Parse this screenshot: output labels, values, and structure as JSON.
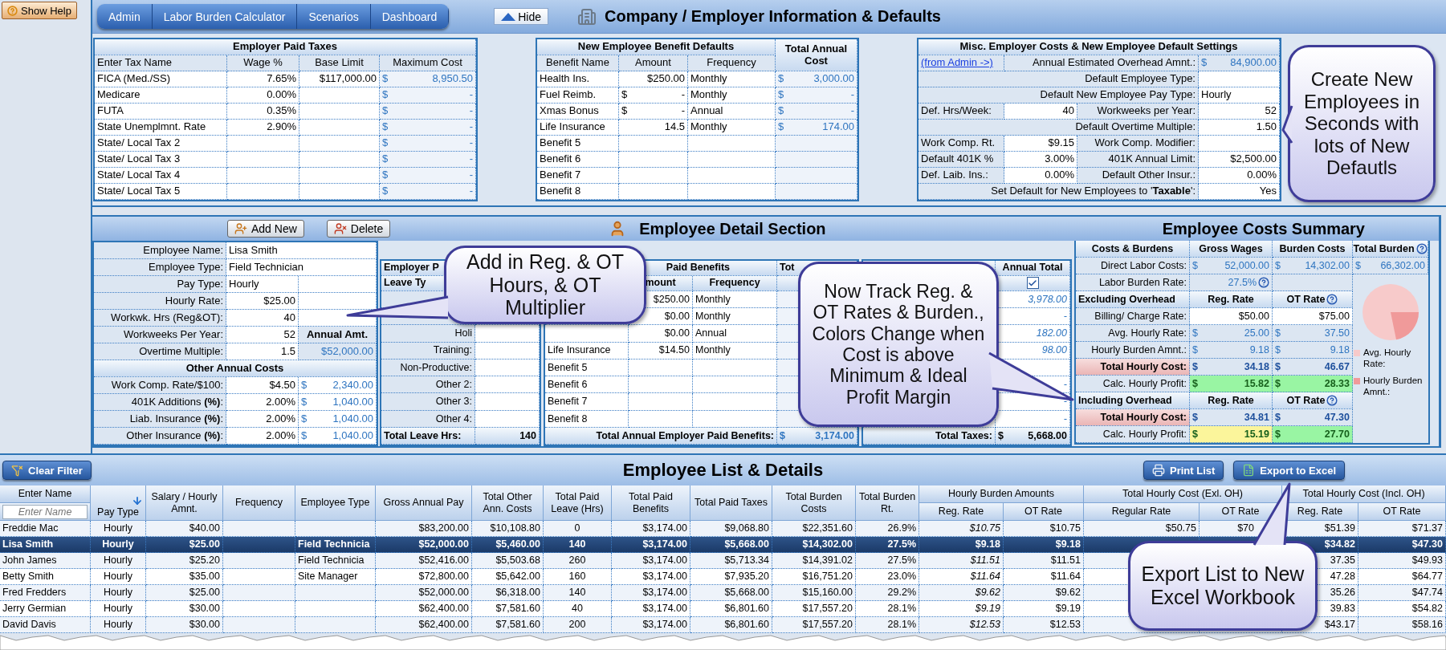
{
  "show_help": "Show Help",
  "nav": {
    "buttons": [
      "Admin",
      "Labor Burden Calculator",
      "Scenarios",
      "Dashboard"
    ],
    "hide_button": "Hide",
    "title": "Company / Employer Information & Defaults"
  },
  "company": {
    "taxes": {
      "title": "Employer Paid Taxes",
      "columns": [
        "Enter Tax Name",
        "Wage %",
        "Base Limit",
        "Maximum Cost"
      ],
      "rows": [
        [
          "FICA (Med./SS)",
          "7.65%",
          "$117,000.00",
          {
            "s": "$",
            "v": "8,950.50"
          }
        ],
        [
          "Medicare",
          "0.00%",
          null,
          {
            "s": "$",
            "v": "-"
          }
        ],
        [
          "FUTA",
          "0.35%",
          null,
          {
            "s": "$",
            "v": "-"
          }
        ],
        [
          "State Unemplmnt. Rate",
          "2.90%",
          null,
          {
            "s": "$",
            "v": "-"
          }
        ],
        [
          "State/ Local Tax 2",
          null,
          null,
          {
            "s": "$",
            "v": "-"
          }
        ],
        [
          "State/ Local Tax 3",
          null,
          null,
          {
            "s": "$",
            "v": "-"
          }
        ],
        [
          "State/ Local Tax 4",
          null,
          null,
          {
            "s": "$",
            "v": "-"
          }
        ],
        [
          "State/ Local Tax 5",
          null,
          null,
          {
            "s": "$",
            "v": "-"
          }
        ]
      ]
    },
    "benefit_defaults": {
      "title": "New Employee Benefit Defaults",
      "total_title": "Total Annual Cost",
      "columns": [
        "Benefit Name",
        "Amount",
        "Frequency"
      ],
      "rows": [
        [
          "Health Ins.",
          "$250.00",
          "Monthly",
          {
            "s": "$",
            "v": "3,000.00"
          }
        ],
        [
          "Fuel Reimb.",
          {
            "s": "$",
            "v": "-"
          },
          "Monthly",
          {
            "s": "$",
            "v": "-"
          }
        ],
        [
          "Xmas Bonus",
          {
            "s": "$",
            "v": "-"
          },
          "Annual",
          {
            "s": "$",
            "v": "-"
          }
        ],
        [
          "Life Insurance",
          "14.5",
          "Monthly",
          {
            "s": "$",
            "v": "174.00"
          }
        ],
        [
          "Benefit 5",
          null,
          null,
          null
        ],
        [
          "Benefit 6",
          null,
          null,
          null
        ],
        [
          "Benefit 7",
          null,
          null,
          null
        ],
        [
          "Benefit 8",
          null,
          null,
          null
        ]
      ]
    },
    "misc": {
      "title": "Misc. Employer Costs & New Employee Default Settings",
      "rows": [
        {
          "kind": "link",
          "link": "(from Admin ->)",
          "label": "Annual Estimated Overhead Amnt.:",
          "value": {
            "s": "$",
            "v": "84,900.00"
          }
        },
        {
          "kind": "single",
          "label": "Default Employee Type:"
        },
        {
          "kind": "choice",
          "label": "Default New Employee Pay Type:",
          "value": "Hourly"
        },
        {
          "kind": "pair",
          "label": "Def. Hrs/Week:",
          "value": "40",
          "label2": "Workweeks per Year:",
          "value2": "52"
        },
        {
          "kind": "single",
          "label": "Default Overtime Multiple:",
          "value": "1.50"
        },
        {
          "kind": "pair",
          "label": "Work Comp. Rt.",
          "value": "$9.15",
          "label2": "Work Comp. Modifier:"
        },
        {
          "kind": "pair",
          "label": "Default 401K %",
          "value": "3.00%",
          "label2": "401K Annual Limit:",
          "value2": "$2,500.00"
        },
        {
          "kind": "pair",
          "label": "Def. Laib. Ins.:",
          "value": "0.00%",
          "label2": "Default Other Insur.:",
          "value2": "0.00%"
        },
        {
          "kind": "single",
          "label": "Set Default for New Employees to '**Taxable**':",
          "value": "Yes"
        }
      ]
    }
  },
  "detail": {
    "add_button": "Add New",
    "delete_button": "Delete",
    "title": "Employee Detail Section",
    "summary_title": "Employee Costs Summary",
    "employee": {
      "rows": [
        {
          "kind": "wide",
          "label": "Employee Name:",
          "value": "Lisa Smith"
        },
        {
          "kind": "wide",
          "label": "Employee Type:",
          "value": "Field Technician"
        },
        {
          "kind": "split",
          "label": "Pay Type:",
          "value": "Hourly"
        },
        {
          "kind": "split",
          "label": "Hourly Rate:",
          "value": "$25.00"
        },
        {
          "kind": "split",
          "label": "Workwk. Hrs (Reg&OT):",
          "value": "40"
        },
        {
          "kind": "split",
          "label": "Workweeks Per Year:",
          "value": "52",
          "heading": "Annual Amt."
        },
        {
          "kind": "split",
          "label": "Overtime Multiple:",
          "value": "1.5",
          "amount": "$52,000.00"
        }
      ],
      "other_title": "Other  Annual Costs",
      "other_rows": [
        {
          "label": "Work Comp. Rate/$100:",
          "value": "$4.50",
          "amount": {
            "s": "$",
            "v": "2,340.00"
          }
        },
        {
          "label": "401K Additions **(%)**:",
          "value": "2.00%",
          "amount": {
            "s": "$",
            "v": "1,040.00"
          }
        },
        {
          "label": "Liab. Insurance **(%)**:",
          "value": "2.00%",
          "amount": {
            "s": "$",
            "v": "1,040.00"
          }
        },
        {
          "label": "Other Insurance **(%)**:",
          "value": "2.00%",
          "amount": {
            "s": "$",
            "v": "1,040.00"
          }
        }
      ]
    },
    "leave": {
      "title": "Employer P",
      "column": "Leave Ty",
      "rows": [
        null,
        null,
        "Holi",
        "Training:",
        "Non-Productive:",
        "Other 2:",
        "Other 3:",
        "Other 4:"
      ],
      "footer_label": "Total Leave Hrs:",
      "footer_value": "140"
    },
    "emp_benefits": {
      "title": "Paid Benefits",
      "total_column": "Tot",
      "columns": [
        "mount",
        "Frequency"
      ],
      "rows": [
        {
          "amount": "$250.00",
          "frequency": "Monthly"
        },
        {
          "amount": "$0.00",
          "frequency": "Monthly"
        },
        {
          "amount": "$0.00",
          "frequency": "Annual"
        },
        {
          "name": "Life Insurance",
          "amount": "$14.50",
          "frequency": "Monthly"
        },
        {
          "name": "Benefit 5"
        },
        {
          "name": "Benefit 6"
        },
        {
          "name": "Benefit 7"
        },
        {
          "name": "Benefit 8"
        }
      ],
      "footer_label": "Total Annual Employer Paid Benefits:",
      "footer_total": {
        "s": "$",
        "v": "3,174.00"
      }
    },
    "emp_taxes": {
      "column": "Annual Total",
      "checked": true,
      "rows": [
        "3,978.00",
        "-",
        "182.00",
        "98.00",
        null,
        "-",
        "-",
        "-"
      ],
      "footer_label": "Total Taxes:",
      "footer_total": {
        "s": "$",
        "v": "5,668.00"
      }
    },
    "summary": {
      "columns": [
        "Costs & Burdens",
        "Gross Wages",
        "Burden Costs",
        "Total Burden"
      ],
      "direct_label": "Direct Labor Costs:",
      "direct_values": [
        {
          "s": "$",
          "v": "52,000.00"
        },
        {
          "s": "$",
          "v": "14,302.00"
        },
        {
          "s": "$",
          "v": "66,302.00"
        }
      ],
      "rows": [
        {
          "kind": "rate",
          "label": "Labor Burden Rate:",
          "reg": "27.5%",
          "help": true
        },
        {
          "kind": "section",
          "label": "Excluding Overhead",
          "reg": "Reg. Rate",
          "ot": "OT Rate",
          "help": true
        },
        {
          "kind": "value",
          "label": "Billing/ Charge Rate:",
          "reg": "$50.00",
          "ot": "$75.00"
        },
        {
          "kind": "value",
          "label": "Avg. Hourly Rate:",
          "reg": {
            "s": "$",
            "v": "25.00"
          },
          "ot": {
            "s": "$",
            "v": "37.50"
          }
        },
        {
          "kind": "value",
          "label": "Hourly Burden Amnt.:",
          "reg": {
            "s": "$",
            "v": "9.18"
          },
          "ot": {
            "s": "$",
            "v": "9.18"
          }
        },
        {
          "kind": "cost",
          "label": "Total Hourly Cost:",
          "reg": {
            "s": "$",
            "v": "34.18"
          },
          "ot": {
            "s": "$",
            "v": "46.67"
          }
        },
        {
          "kind": "profit",
          "label": "Calc. Hourly Profit:",
          "reg": {
            "s": "$",
            "v": "15.82",
            "color": "#99f5a3"
          },
          "ot": {
            "s": "$",
            "v": "28.33",
            "color": "#99f5a3"
          }
        },
        {
          "kind": "section",
          "label": "Including Overhead",
          "reg": "Reg. Rate",
          "ot": "OT Rate",
          "help": true
        },
        {
          "kind": "cost",
          "label": "Total Hourly Cost:",
          "reg": {
            "s": "$",
            "v": "34.81"
          },
          "ot": {
            "s": "$",
            "v": "47.30"
          }
        },
        {
          "kind": "profit",
          "label": "Calc. Hourly Profit:",
          "reg": {
            "s": "$",
            "v": "15.19",
            "color": "#fbf59b"
          },
          "ot": {
            "s": "$",
            "v": "27.70",
            "color": "#99f5a3"
          }
        }
      ],
      "total_help": true,
      "legend": [
        {
          "label": "Avg. Hourly Rate:",
          "color": "#f7caca"
        },
        {
          "label": "Hourly Burden Amnt.:",
          "color": "#f09a9a"
        }
      ]
    }
  },
  "list": {
    "clear_filter": "Clear Filter",
    "title": "Employee List & Details",
    "print_button": "Print List",
    "export_button": "Export to Excel",
    "header": [
      {
        "kind": "filter",
        "label": "Enter Name",
        "placeholder": "Enter Name"
      },
      {
        "kind": "single",
        "label": "Pay Type",
        "sorted": true
      },
      {
        "kind": "single",
        "label": "Salary / Hourly Amnt."
      },
      {
        "kind": "single",
        "label": "Frequency"
      },
      {
        "kind": "single",
        "label": "Employee Type"
      },
      {
        "kind": "single",
        "label": "Gross Annual Pay"
      },
      {
        "kind": "single",
        "label": "Total Other Ann. Costs"
      },
      {
        "kind": "single",
        "label": "Total Paid Leave (Hrs)"
      },
      {
        "kind": "single",
        "label": "Total Paid Benefits"
      },
      {
        "kind": "single",
        "label": "Total Paid Taxes"
      },
      {
        "kind": "single",
        "label": "Total Burden Costs"
      },
      {
        "kind": "single",
        "label": "Total Burden Rt."
      },
      {
        "kind": "group",
        "label": "Hourly Burden Amounts",
        "subs": [
          "Reg. Rate",
          "OT Rate"
        ]
      },
      {
        "kind": "group",
        "label": "Total Hourly Cost (Exl. OH)",
        "subs": [
          "Regular Rate",
          "OT Rate"
        ]
      },
      {
        "kind": "group",
        "label": "Total Hourly Cost (Incl. OH)",
        "subs": [
          "Reg. Rate",
          "OT Rate"
        ]
      }
    ],
    "rows": [
      {
        "selected": false,
        "cells": [
          "Freddie Mac",
          "Hourly",
          "$40.00",
          null,
          null,
          "$83,200.00",
          "$10,108.80",
          "0",
          "$3,174.00",
          "$9,068.80",
          "$22,351.60",
          "26.9%",
          "$10.75",
          "$10.75",
          "$50.75",
          "$70",
          "$51.39",
          "$71.37"
        ]
      },
      {
        "selected": true,
        "cells": [
          "Lisa Smith",
          "Hourly",
          "$25.00",
          null,
          "Field Technicia",
          "$52,000.00",
          "$5,460.00",
          "140",
          "$3,174.00",
          "$5,668.00",
          "$14,302.00",
          "27.5%",
          "$9.18",
          "$9.18",
          null,
          null,
          "$34.82",
          "$47.30"
        ]
      },
      {
        "selected": false,
        "cells": [
          "John James",
          "Hourly",
          "$25.20",
          null,
          "Field Technicia",
          "$52,416.00",
          "$5,503.68",
          "260",
          "$3,174.00",
          "$5,713.34",
          "$14,391.02",
          "27.5%",
          "$11.51",
          "$11.51",
          null,
          null,
          "37.35",
          "$49.93"
        ]
      },
      {
        "selected": false,
        "cells": [
          "Betty Smith",
          "Hourly",
          "$35.00",
          null,
          "Site Manager",
          "$72,800.00",
          "$5,642.00",
          "160",
          "$3,174.00",
          "$7,935.20",
          "$16,751.20",
          "23.0%",
          "$11.64",
          "$11.64",
          null,
          null,
          "47.28",
          "$64.77"
        ]
      },
      {
        "selected": false,
        "cells": [
          "Fred Fredders",
          "Hourly",
          "$25.00",
          null,
          null,
          "$52,000.00",
          "$6,318.00",
          "140",
          "$3,174.00",
          "$5,668.00",
          "$15,160.00",
          "29.2%",
          "$9.62",
          "$9.62",
          null,
          null,
          "35.26",
          "$47.74"
        ]
      },
      {
        "selected": false,
        "cells": [
          "Jerry Germian",
          "Hourly",
          "$30.00",
          null,
          null,
          "$62,400.00",
          "$7,581.60",
          "40",
          "$3,174.00",
          "$6,801.60",
          "$17,557.20",
          "28.1%",
          "$9.19",
          "$9.19",
          null,
          null,
          "39.83",
          "$54.82"
        ]
      },
      {
        "selected": false,
        "cells": [
          "David Davis",
          "Hourly",
          "$30.00",
          null,
          null,
          "$62,400.00",
          "$7,581.60",
          "200",
          "$3,174.00",
          "$6,801.60",
          "$17,557.20",
          "28.1%",
          "$12.53",
          "$12.53",
          null,
          null,
          "$43.17",
          "$58.16"
        ]
      }
    ]
  },
  "callouts": [
    {
      "text": "Create New Employees in Seconds with lots of New Defautls"
    },
    {
      "text": "Add in Reg. & OT Hours, & OT Multiplier"
    },
    {
      "text": "Now Track Reg. & OT Rates & Burden., Colors Change when Cost is above Minimum & Ideal Profit Margin"
    },
    {
      "text": "Export List to New Excel Workbook"
    }
  ]
}
